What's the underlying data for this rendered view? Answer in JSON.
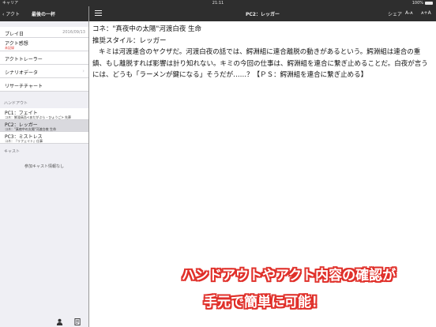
{
  "status": {
    "carrier": "キャリア",
    "time": "21:11",
    "battery": "100%"
  },
  "sidebar": {
    "back_label": "アクト",
    "title": "最後の一杯",
    "play_day": {
      "label": "プレイ日",
      "value": "2016/09/13"
    },
    "impression": {
      "label": "アクト感想",
      "sub": "未記録"
    },
    "rows": [
      {
        "label": "アクトトレーラー"
      },
      {
        "label": "シナリオデータ",
        "chevron": "›"
      },
      {
        "label": "リサーチチャート"
      }
    ],
    "handout_header": "ハンドアウト",
    "handouts": [
      {
        "label": "PC1：フェイト",
        "sub": "コネ：鮮淵高吾<あだがぶら・ひょうご> 先葬"
      },
      {
        "label": "PC2：レッガー",
        "sub": "コネ：\"真夜中の太陽\"河渡白夜 生命"
      },
      {
        "label": "PC3：ミストレス",
        "sub": "コネ：『リフェイト』仕事"
      }
    ],
    "cast_header": "キャスト",
    "cast_empty": "参加キャスト情報なし"
  },
  "main": {
    "title": "PC2：レッガー",
    "share": "シェア",
    "font_small": "A-ᴀ",
    "font_large": "ᴀ+A",
    "connection": "コネ：\"真夜中の太陽\"河渡白夜 生命",
    "style": "推奨スタイル：レッガー",
    "body": "キミは河渡連合のヤクザだ。河渡白夜の話では、鰐淵組に連合離脱の動きがあるという。鰐淵組は連合の重鎮、もし離脱すれば影響は計り知れない。キミの今回の仕事は、鰐淵組を連合に繋ぎ止めることだ。白夜が言うには、どうも「ラーメンが鍵になる」そうだが……？【ＰＳ：鰐淵組を連合に繋ぎ止める】"
  },
  "caption": {
    "line1": "ハンドアウトやアクト内容の確認が",
    "line2": "手元で簡単に可能！"
  },
  "colors": {
    "accent_red": "#e0302a",
    "nav_bg": "#2e2e2e",
    "sidebar_bg": "#efeff4"
  }
}
